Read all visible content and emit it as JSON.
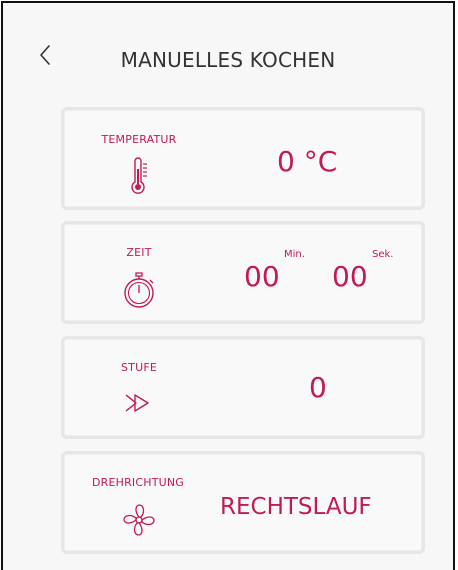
{
  "header": {
    "title": "MANUELLES KOCHEN",
    "back_icon": "chevron-left-icon"
  },
  "colors": {
    "accent": "#c21a54",
    "text": "#333333",
    "card_border": "#e6e6e6",
    "background": "#f7f7f7"
  },
  "cards": {
    "temperature": {
      "label": "TEMPERATUR",
      "icon": "thermometer-icon",
      "value": "0 °C"
    },
    "time": {
      "label": "ZEIT",
      "icon": "stopwatch-icon",
      "minutes": "00",
      "minutes_unit": "Min.",
      "seconds": "00",
      "seconds_unit": "Sek."
    },
    "speed": {
      "label": "STUFE",
      "icon": "fast-forward-icon",
      "value": "0"
    },
    "direction": {
      "label": "DREHRICHTUNG",
      "icon": "fan-icon",
      "value": "RECHTSLAUF"
    }
  }
}
